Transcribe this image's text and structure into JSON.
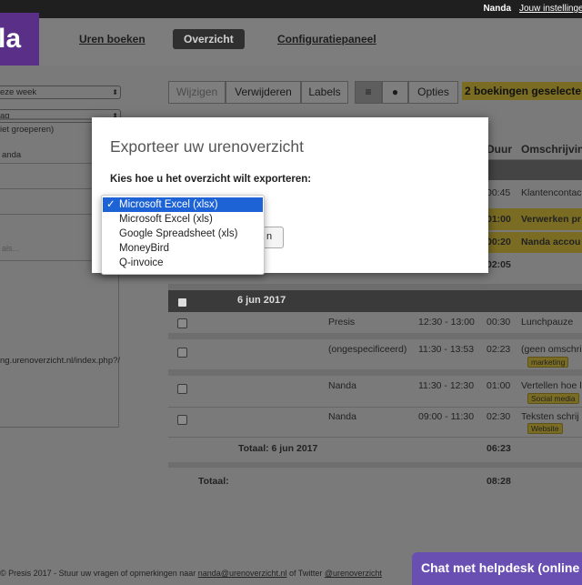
{
  "topbar": {
    "user": "Nanda",
    "settings_link": "Jouw instellinge"
  },
  "logo": {
    "text": "la"
  },
  "nav": {
    "tabs": [
      "Uren boeken",
      "Overzicht",
      "Configuratiepaneel"
    ]
  },
  "left": {
    "period_select": "eze week",
    "group_select": "ag",
    "group_option": "iet groeperen)",
    "user_value": "anda",
    "placeholder": "als...",
    "url_text": "ng.urenoverzicht.nl/index.php?/"
  },
  "toolbar": {
    "edit": "Wijzigen",
    "delete": "Verwijderen",
    "labels": "Labels",
    "options": "Opties",
    "selected_badge": "2 boekingen geselecte"
  },
  "table": {
    "col_duration": "Duur",
    "col_description": "Omschrijvin",
    "upper_rows": [
      {
        "duration": "00:45",
        "desc": "Klantencontac"
      },
      {
        "duration": "01:00",
        "desc": "Verwerken pr"
      },
      {
        "duration": "00:20",
        "desc": "Nanda accou"
      },
      {
        "duration": "02:05",
        "desc": ""
      }
    ],
    "day_header": "6 jun 2017",
    "rows": [
      {
        "user": "Presis",
        "time": "12:30 - 13:00",
        "duration": "00:30",
        "desc": "Lunchpauze",
        "tag": ""
      },
      {
        "user": "(ongespecificeerd)",
        "time": "11:30 - 13:53",
        "duration": "02:23",
        "desc": "(geen omschri",
        "tag": "marketing"
      },
      {
        "user": "Nanda",
        "time": "11:30 - 12:30",
        "duration": "01:00",
        "desc": "Vertellen hoe l",
        "tag": "Social media"
      },
      {
        "user": "Nanda",
        "time": "09:00 - 11:30",
        "duration": "02:30",
        "desc": "Teksten schrij",
        "tag": "Website"
      }
    ],
    "day_total_label": "Totaal: 6 jun 2017",
    "day_total": "06:23",
    "grand_total_label": "Totaal:",
    "grand_total": "08:28"
  },
  "modal": {
    "title": "Exporteer uw urenoverzicht",
    "subtitle": "Kies hoe u het overzicht wilt exporteren:",
    "options": [
      "Microsoft Excel (xlsx)",
      "Microsoft Excel (xls)",
      "Google Spreadsheet (xls)",
      "MoneyBird",
      "Q-invoice"
    ],
    "selected": "Microsoft Excel (xlsx)",
    "button_fragment": "n"
  },
  "footer": {
    "prefix": "Presis 2017 - Stuur uw vragen of opmerkingen naar ",
    "email": "nanda@urenoverzicht.nl",
    "middle": " of Twitter ",
    "twitter": "@urenoverzicht",
    "chat": "Chat met helpdesk (online"
  },
  "colors": {
    "accent_purple": "#5a2f87",
    "badge_yellow": "#7a6d23",
    "select_blue": "#1e63d6"
  }
}
